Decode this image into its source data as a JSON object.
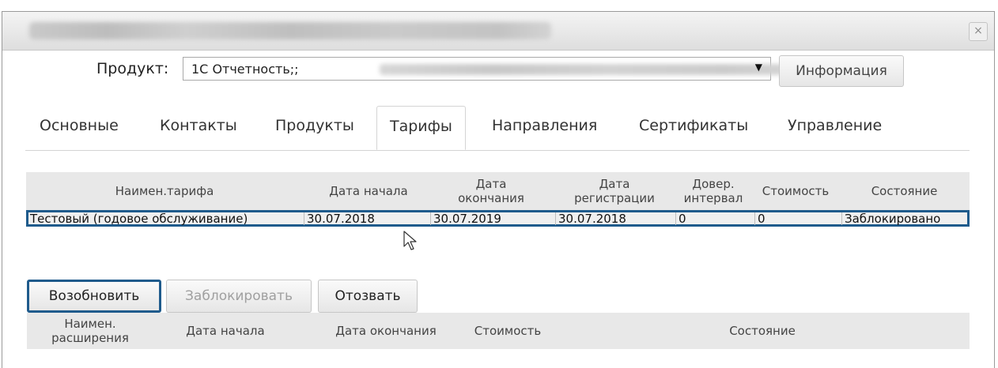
{
  "dialog": {
    "close_glyph": "×"
  },
  "product": {
    "label": "Продукт:",
    "value": "1С Отчетность;;",
    "info_button": "Информация"
  },
  "tabs": [
    {
      "label": "Основные"
    },
    {
      "label": "Контакты"
    },
    {
      "label": "Продукты"
    },
    {
      "label": "Тарифы",
      "active": true
    },
    {
      "label": "Направления"
    },
    {
      "label": "Сертификаты"
    },
    {
      "label": "Управление"
    }
  ],
  "tariffs": {
    "headers": {
      "name": "Наимен.тарифа",
      "start": "Дата начала",
      "end1": "Дата",
      "end2": "окончания",
      "reg1": "Дата",
      "reg2": "регистрации",
      "trust1": "Довер.",
      "trust2": "интервал",
      "cost": "Стоимость",
      "state": "Состояние"
    },
    "rows": [
      {
        "name": "Тестовый (годовое обслуживание)",
        "start": "30.07.2018",
        "end": "30.07.2019",
        "reg": "30.07.2018",
        "trust": "0",
        "cost": "0",
        "state": "Заблокировано"
      }
    ]
  },
  "actions": {
    "renew": "Возобновить",
    "block": "Заблокировать",
    "revoke": "Отозвать"
  },
  "extensions": {
    "headers": {
      "name1": "Наимен.",
      "name2": "расширения",
      "start": "Дата начала",
      "end": "Дата окончания",
      "cost": "Стоимость",
      "state": "Состояние"
    }
  },
  "colors": {
    "highlight": "#1f5b8c"
  }
}
